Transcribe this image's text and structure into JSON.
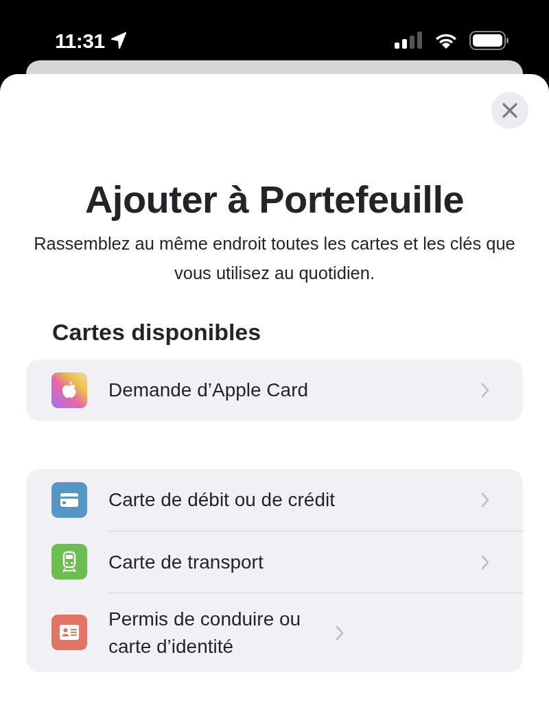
{
  "status_bar": {
    "time": "11:31"
  },
  "sheet": {
    "title": "Ajouter à Portefeuille",
    "subtitle": "Rassemblez au même endroit toutes les cartes et les clés que vous utilisez au quotidien.",
    "section_title": "Cartes disponibles",
    "groups": [
      {
        "items": [
          {
            "kind": "apple",
            "label": "Demande d’Apple Card"
          }
        ]
      },
      {
        "items": [
          {
            "kind": "card",
            "color": "#5696c6",
            "label": "Carte de débit ou de crédit"
          },
          {
            "kind": "train",
            "color": "#6cbd52",
            "label": "Carte de transport"
          },
          {
            "kind": "id",
            "color": "#e07565",
            "label": "Permis de conduire ou carte d’identité"
          }
        ]
      }
    ]
  }
}
